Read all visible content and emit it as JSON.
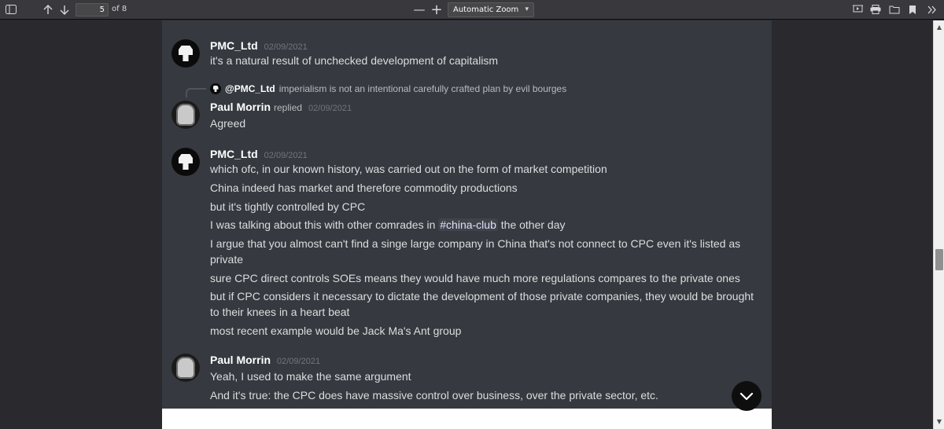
{
  "toolbar": {
    "page_number": "5",
    "page_count_label": "of 8",
    "zoom_label": "Automatic Zoom",
    "zoom_out": "—",
    "zoom_in": "+"
  },
  "messages": {
    "m1": {
      "username": "PMC_Ltd",
      "timestamp": "02/09/2021",
      "lines": [
        "it's a natural result of unchecked development of capitalism"
      ]
    },
    "m2": {
      "reply_to": "@PMC_Ltd",
      "reply_text": "imperialism is not an intentional carefully crafted plan by evil bourges",
      "username": "Paul Morrin",
      "replied_label": "replied",
      "timestamp": "02/09/2021",
      "lines": [
        "Agreed"
      ]
    },
    "m3": {
      "username": "PMC_Ltd",
      "timestamp": "02/09/2021",
      "line0": "which ofc, in our known history, was carried out on the form of market competition",
      "line1": "China indeed has market and therefore commodity productions",
      "line2": "but it's tightly controlled by CPC",
      "line3_pre": "I was talking about this with other comrades in ",
      "line3_channel": "#china-club",
      "line3_post": " the other day",
      "line4": "I argue that you almost can't find a singe large company in China that's not connect to CPC even it's listed as private",
      "line5": "sure CPC direct controls SOEs means they would have much more regulations compares to the private ones",
      "line6": "but if CPC considers it necessary to dictate the development of those private companies, they would be brought to their knees in a heart beat",
      "line7": "most recent example would be Jack Ma's Ant group"
    },
    "m4": {
      "username": "Paul Morrin",
      "timestamp": "02/09/2021",
      "line0": "Yeah, I used to make the same argument",
      "line1": "And it's true: the CPC does have massive control over business, over the private sector, etc."
    }
  },
  "icons": {
    "sidebar_toggle": "sidebar-toggle-icon",
    "prev": "arrow-up-icon",
    "next": "arrow-down-icon",
    "presentation": "presentation-icon",
    "print": "print-icon",
    "open": "open-file-icon",
    "bookmark": "bookmark-icon",
    "more": "double-chevron-right-icon",
    "jump": "chevron-down-icon"
  },
  "colors": {
    "toolbar_bg": "#38383d",
    "chat_bg": "#36393f",
    "text": "#dcddde",
    "username": "#ffffff",
    "timestamp": "#72767d"
  }
}
